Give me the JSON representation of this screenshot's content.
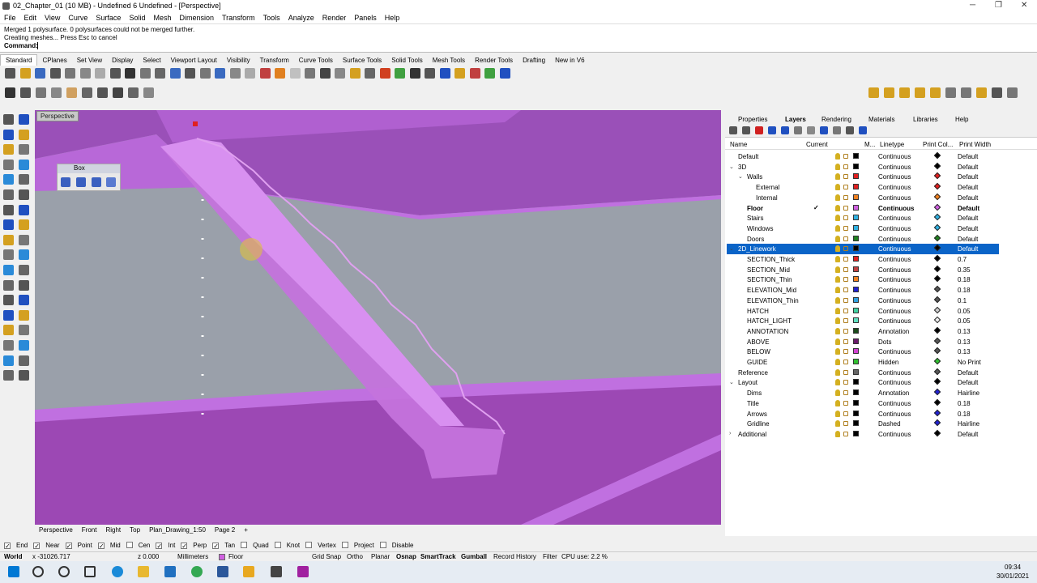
{
  "window": {
    "title": "02_Chapter_01 (10 MB) - Undefined 6 Undefined - [Perspective]",
    "min": "─",
    "max": "❐",
    "close": "✕"
  },
  "menu": [
    "File",
    "Edit",
    "View",
    "Curve",
    "Surface",
    "Solid",
    "Mesh",
    "Dimension",
    "Transform",
    "Tools",
    "Analyze",
    "Render",
    "Panels",
    "Help"
  ],
  "command": {
    "history1": "Merged 1 polysurface. 0 polysurfaces could not be merged further.",
    "history2": "Creating meshes... Press Esc to cancel",
    "prompt": "Command:"
  },
  "toolbar_tabs": [
    "Standard",
    "CPlanes",
    "Set View",
    "Display",
    "Select",
    "Viewport Layout",
    "Visibility",
    "Transform",
    "Curve Tools",
    "Surface Tools",
    "Solid Tools",
    "Mesh Tools",
    "Render Tools",
    "Drafting",
    "New in V6"
  ],
  "viewport": {
    "label": "Perspective"
  },
  "box_panel": {
    "title": "Box"
  },
  "viewport_tabs": [
    "Perspective",
    "Front",
    "Right",
    "Top",
    "Plan_Drawing_1:50",
    "Page 2",
    "+"
  ],
  "osnaps": [
    {
      "label": "End",
      "checked": true
    },
    {
      "label": "Near",
      "checked": true
    },
    {
      "label": "Point",
      "checked": true
    },
    {
      "label": "Mid",
      "checked": true
    },
    {
      "label": "Cen",
      "checked": false
    },
    {
      "label": "Int",
      "checked": true
    },
    {
      "label": "Perp",
      "checked": true
    },
    {
      "label": "Tan",
      "checked": true
    },
    {
      "label": "Quad",
      "checked": false
    },
    {
      "label": "Knot",
      "checked": false
    },
    {
      "label": "Vertex",
      "checked": false
    },
    {
      "label": "Project",
      "checked": false
    },
    {
      "label": "Disable",
      "checked": false
    }
  ],
  "status": {
    "cplane": "World",
    "x": "x -31026.717",
    "z": "z 0.000",
    "units": "Millimeters",
    "layer": "Floor",
    "gridsnap": "Grid Snap",
    "ortho": "Ortho",
    "planar": "Planar",
    "osnap": "Osnap",
    "smarttrack": "SmartTrack",
    "gumball": "Gumball",
    "history": "Record History",
    "filter": "Filter",
    "cpu": "CPU use: 2.2 %"
  },
  "panel_tabs": [
    "Properties",
    "Layers",
    "Rendering",
    "Materials",
    "Libraries",
    "Help"
  ],
  "layer_header": {
    "name": "Name",
    "current": "Current",
    "m": "M...",
    "linetype": "Linetype",
    "printcol": "Print Col...",
    "printwidth": "Print Width"
  },
  "layers": [
    {
      "name": "Default",
      "indent": 1,
      "toggle": "",
      "color": "#000000",
      "linetype": "Continuous",
      "printcolor": "#000000",
      "width": "Default"
    },
    {
      "name": "3D",
      "indent": 1,
      "toggle": "v",
      "color": "#000000",
      "linetype": "Continuous",
      "printcolor": "#000000",
      "width": "Default"
    },
    {
      "name": "Walls",
      "indent": 2,
      "toggle": "v",
      "color": "#e02020",
      "linetype": "Continuous",
      "printcolor": "#e02020",
      "width": "Default"
    },
    {
      "name": "External",
      "indent": 3,
      "toggle": "",
      "color": "#e02020",
      "linetype": "Continuous",
      "printcolor": "#e02020",
      "width": "Default"
    },
    {
      "name": "Internal",
      "indent": 3,
      "toggle": "",
      "color": "#f08020",
      "linetype": "Continuous",
      "printcolor": "#f08020",
      "width": "Default"
    },
    {
      "name": "Floor",
      "indent": 2,
      "toggle": "",
      "color": "#d060e0",
      "linetype": "Continuous",
      "printcolor": "#d060e0",
      "width": "Default",
      "bold": true,
      "current": "✓"
    },
    {
      "name": "Stairs",
      "indent": 2,
      "toggle": "",
      "color": "#30b0e0",
      "linetype": "Continuous",
      "printcolor": "#30b0e0",
      "width": "Default"
    },
    {
      "name": "Windows",
      "indent": 2,
      "toggle": "",
      "color": "#30b0e0",
      "linetype": "Continuous",
      "printcolor": "#30b0e0",
      "width": "Default"
    },
    {
      "name": "Doors",
      "indent": 2,
      "toggle": "",
      "color": "#208020",
      "linetype": "Continuous",
      "printcolor": "#208020",
      "width": "Default"
    },
    {
      "name": "2D_Linework",
      "indent": 1,
      "toggle": "v",
      "color": "#000000",
      "linetype": "Continuous",
      "printcolor": "#000000",
      "width": "Default",
      "selected": true
    },
    {
      "name": "SECTION_Thick",
      "indent": 2,
      "toggle": "",
      "color": "#e02020",
      "linetype": "Continuous",
      "printcolor": "#000000",
      "width": "0.7"
    },
    {
      "name": "SECTION_Mid",
      "indent": 2,
      "toggle": "",
      "color": "#c04040",
      "linetype": "Continuous",
      "printcolor": "#000000",
      "width": "0.35"
    },
    {
      "name": "SECTION_Thin",
      "indent": 2,
      "toggle": "",
      "color": "#f08020",
      "linetype": "Continuous",
      "printcolor": "#000000",
      "width": "0.18"
    },
    {
      "name": "ELEVATION_Mid",
      "indent": 2,
      "toggle": "",
      "color": "#2020d0",
      "linetype": "Continuous",
      "printcolor": "#555555",
      "width": "0.18"
    },
    {
      "name": "ELEVATION_Thin",
      "indent": 2,
      "toggle": "",
      "color": "#30a0e0",
      "linetype": "Continuous",
      "printcolor": "#555555",
      "width": "0.1"
    },
    {
      "name": "HATCH",
      "indent": 2,
      "toggle": "",
      "color": "#40d0a0",
      "linetype": "Continuous",
      "printcolor": "#cccccc",
      "width": "0.05"
    },
    {
      "name": "HATCH_LIGHT",
      "indent": 2,
      "toggle": "",
      "color": "#60e0c0",
      "linetype": "Continuous",
      "printcolor": "#eeeeee",
      "width": "0.05"
    },
    {
      "name": "ANNOTATION",
      "indent": 2,
      "toggle": "",
      "color": "#1a4a1a",
      "linetype": "Annotation",
      "printcolor": "#000000",
      "width": "0.13"
    },
    {
      "name": "ABOVE",
      "indent": 2,
      "toggle": "",
      "color": "#6a1a6a",
      "linetype": "Dots",
      "printcolor": "#555555",
      "width": "0.13"
    },
    {
      "name": "BELOW",
      "indent": 2,
      "toggle": "",
      "color": "#d040d0",
      "linetype": "Continuous",
      "printcolor": "#555555",
      "width": "0.13"
    },
    {
      "name": "GUIDE",
      "indent": 2,
      "toggle": "",
      "color": "#30c030",
      "linetype": "Hidden",
      "printcolor": "#30c030",
      "width": "No Print"
    },
    {
      "name": "Reference",
      "indent": 1,
      "toggle": "",
      "color": "#666666",
      "linetype": "Continuous",
      "printcolor": "#555555",
      "width": "Default"
    },
    {
      "name": "Layout",
      "indent": 1,
      "toggle": "v",
      "color": "#000000",
      "linetype": "Continuous",
      "printcolor": "#000000",
      "width": "Default"
    },
    {
      "name": "Dims",
      "indent": 2,
      "toggle": "",
      "color": "#000000",
      "linetype": "Annotation",
      "printcolor": "#2020d0",
      "width": "Hairline"
    },
    {
      "name": "Title",
      "indent": 2,
      "toggle": "",
      "color": "#000000",
      "linetype": "Continuous",
      "printcolor": "#000000",
      "width": "0.18"
    },
    {
      "name": "Arrows",
      "indent": 2,
      "toggle": "",
      "color": "#000000",
      "linetype": "Continuous",
      "printcolor": "#2020d0",
      "width": "0.18"
    },
    {
      "name": "Gridline",
      "indent": 2,
      "toggle": "",
      "color": "#000000",
      "linetype": "Dashed",
      "printcolor": "#2020d0",
      "width": "Hairline"
    },
    {
      "name": "Additional",
      "indent": 1,
      "toggle": ">",
      "color": "#000000",
      "linetype": "Continuous",
      "printcolor": "#000000",
      "width": "Default"
    }
  ],
  "clock": {
    "time": "09:34",
    "date": "30/01/2021"
  }
}
